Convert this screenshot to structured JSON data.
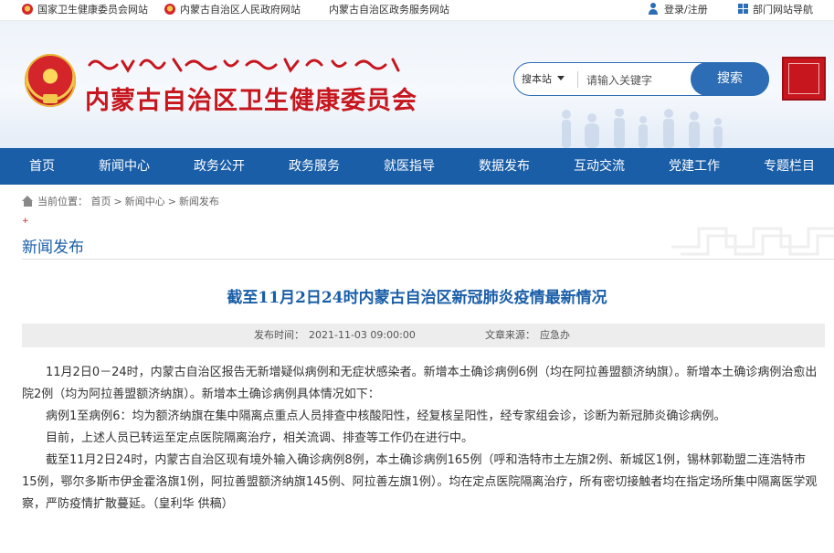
{
  "topbar": {
    "links": [
      "国家卫生健康委员会网站",
      "内蒙古自治区人民政府网站",
      "内蒙古自治区政务服务网站"
    ],
    "login": "登录/注册",
    "dept_nav": "部门网站导航"
  },
  "header": {
    "site_title": "内蒙古自治区卫生健康委员会",
    "search_scope": "搜本站",
    "search_placeholder": "请输入关键字",
    "search_button": "搜索"
  },
  "nav": {
    "items": [
      "首页",
      "新闻中心",
      "政务公开",
      "政务服务",
      "就医指导",
      "数据发布",
      "互动交流",
      "党建工作",
      "专题栏目"
    ]
  },
  "breadcrumb": {
    "label": "当前位置：",
    "items": [
      "首页",
      "新闻中心",
      "新闻发布"
    ],
    "separator": ">"
  },
  "section": {
    "title": "新闻发布"
  },
  "article": {
    "title": "截至11月2日24时内蒙古自治区新冠肺炎疫情最新情况",
    "publish_label": "发布时间：",
    "publish_time": "2021-11-03 09:00:00",
    "source_label": "文章来源：",
    "source": "应急办",
    "paragraphs": [
      "11月2日0－24时，内蒙古自治区报告无新增疑似病例和无症状感染者。新增本土确诊病例6例（均在阿拉善盟额济纳旗）。新增本土确诊病例治愈出院2例（均为阿拉善盟额济纳旗）。新增本土确诊病例具体情况如下：",
      "病例1至病例6：均为额济纳旗在集中隔离点重点人员排查中核酸阳性，经复核呈阳性，经专家组会诊，诊断为新冠肺炎确诊病例。",
      "目前，上述人员已转运至定点医院隔离治疗，相关流调、排查等工作仍在进行中。",
      "截至11月2日24时，内蒙古自治区现有境外输入确诊病例8例，本土确诊病例165例（呼和浩特市土左旗2例、新城区1例，锡林郭勒盟二连浩特市15例，鄂尔多斯市伊金霍洛旗1例，阿拉善盟额济纳旗145例、阿拉善左旗1例）。均在定点医院隔离治疗，所有密切接触者均在指定场所集中隔离医学观察，严防疫情扩散蔓延。（皇利华 供稿）"
    ]
  },
  "colors": {
    "brand_blue": "#1a5ea8",
    "brand_red": "#c7161d",
    "search_blue": "#2d6db5"
  }
}
